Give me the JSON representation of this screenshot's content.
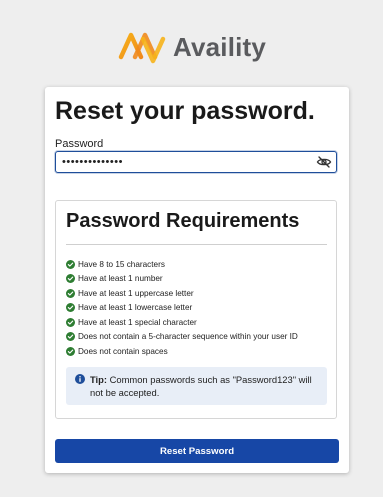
{
  "brand": {
    "name": "Availity",
    "logo_icon": "availity-logo-icon",
    "colors": {
      "orange": "#f08a1c",
      "yellow": "#f6b21a",
      "gray": "#5a5b5e"
    }
  },
  "form": {
    "heading": "Reset your password.",
    "password_label": "Password",
    "password_value": "••••••••••••••",
    "visibility_icon": "eye-slash-icon",
    "submit_label": "Reset Password",
    "accent_color": "#1747a6"
  },
  "requirements": {
    "title": "Password Requirements",
    "status_icon": "check-circle-icon",
    "status_color": "#2e7d32",
    "items": [
      "Have 8 to 15 characters",
      "Have at least 1 number",
      "Have at least 1 uppercase letter",
      "Have at least 1 lowercase letter",
      "Have at least 1 special character",
      "Does not contain a 5-character sequence within your user ID",
      "Does not contain spaces"
    ],
    "tip": {
      "icon": "info-icon",
      "label": "Tip:",
      "text": " Common passwords such as \"Password123\" will not be accepted."
    }
  }
}
